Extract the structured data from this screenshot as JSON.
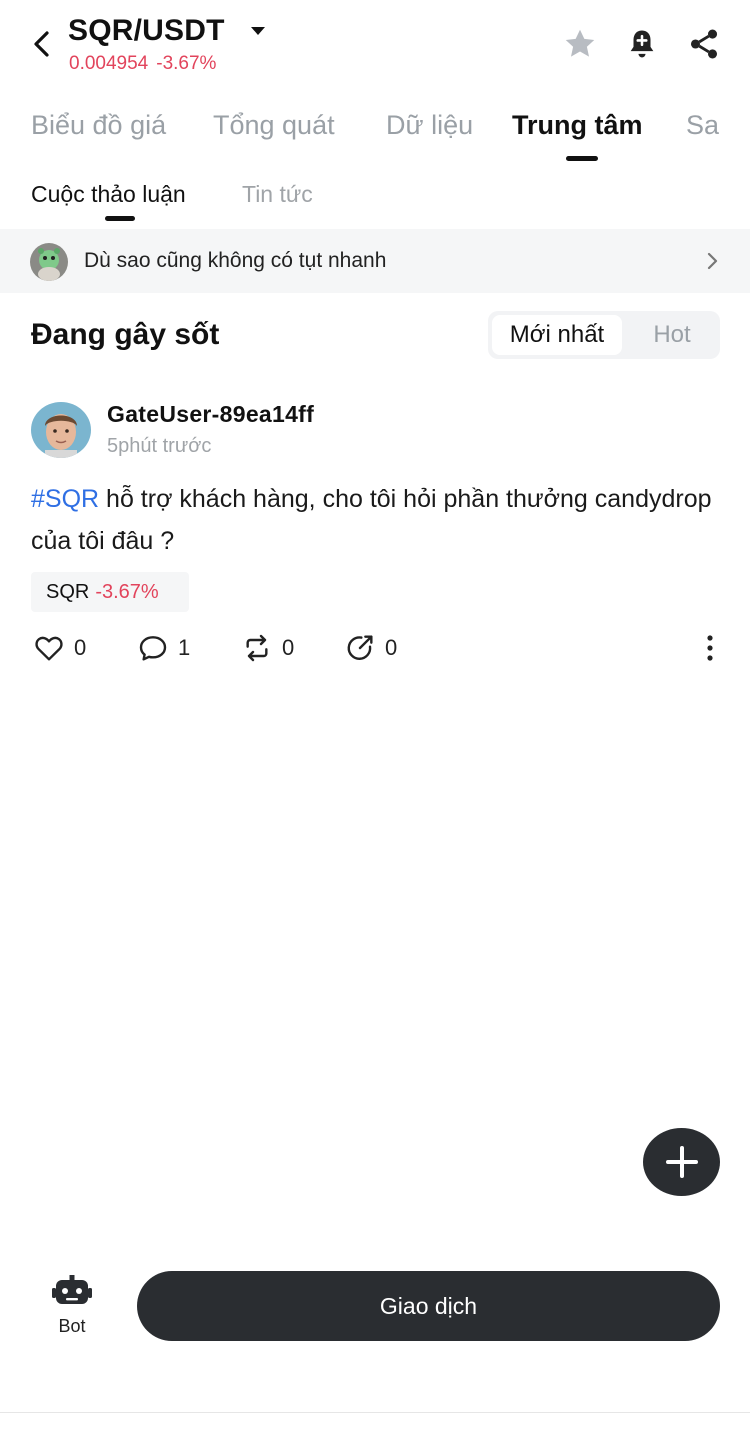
{
  "header": {
    "pair": "SQR/USDT",
    "price": "0.004954",
    "change": "-3.67%",
    "icons": [
      "back-arrow-icon",
      "caret-down-icon",
      "star-icon",
      "alert-bell-icon",
      "share-icon"
    ]
  },
  "main_tabs": [
    {
      "label": "Biểu đồ giá",
      "active": false
    },
    {
      "label": "Tổng quát",
      "active": false
    },
    {
      "label": "Dữ liệu",
      "active": false
    },
    {
      "label": "Trung tâm",
      "active": true
    },
    {
      "label": "Sa",
      "active": false
    }
  ],
  "sub_tabs": [
    {
      "label": "Cuộc thảo luận",
      "active": true
    },
    {
      "label": "Tin tức",
      "active": false
    }
  ],
  "banner": {
    "text": "Dù sao cũng không có tụt nhanh"
  },
  "feed": {
    "title": "Đang gây sốt",
    "sort_options": [
      "Mới nhất",
      "Hot"
    ],
    "selected_sort": "Mới nhất"
  },
  "post": {
    "username": "GateUser-89ea14ff",
    "time": "5phút trước",
    "hashtag": "#SQR",
    "text": " hỗ trợ khách hàng, cho tôi hỏi phần thưởng candydrop của tôi đâu ?",
    "coin": "SQR",
    "coin_change": "-3.67%",
    "likes": "0",
    "comments": "1",
    "reposts": "0",
    "shares": "0"
  },
  "bottom": {
    "bot_label": "Bot",
    "trade_label": "Giao dịch"
  },
  "colors": {
    "negative": "#e2445c",
    "hashtag": "#2f6fe4",
    "dark_button": "#2a2d31"
  }
}
